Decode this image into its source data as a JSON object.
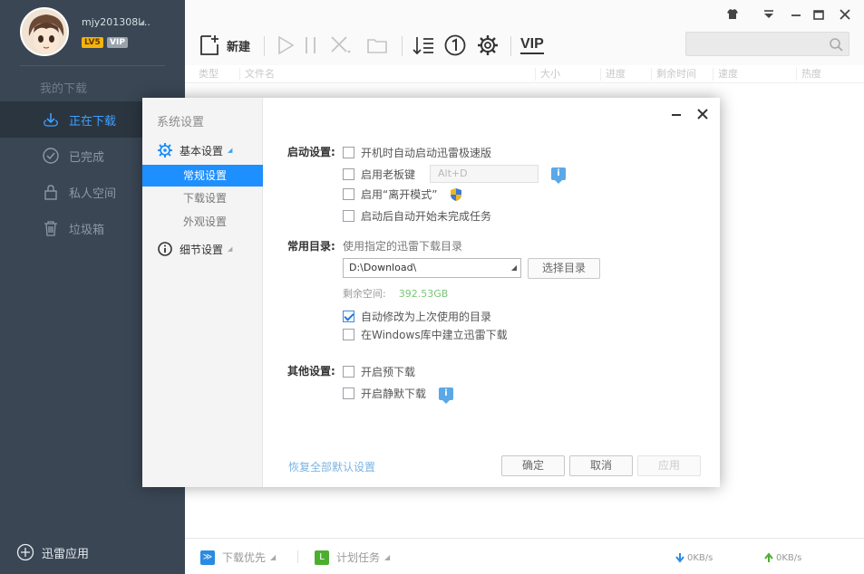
{
  "sidebar": {
    "username": "mjy201308l...",
    "level": "LV5",
    "vip": "VIP",
    "section_title": "我的下载",
    "items": [
      {
        "label": "正在下载",
        "icon": "download-icon",
        "active": true
      },
      {
        "label": "已完成",
        "icon": "check-circle-icon",
        "active": false
      },
      {
        "label": "私人空间",
        "icon": "lock-icon",
        "active": false
      },
      {
        "label": "垃圾箱",
        "icon": "trash-icon",
        "active": false
      }
    ],
    "apps_label": "迅雷应用"
  },
  "toolbar": {
    "new_label": "新建",
    "vip_label": "VIP"
  },
  "columns": [
    "类型",
    "文件名",
    "大小",
    "进度",
    "剩余时间",
    "速度",
    "热度"
  ],
  "statusbar": {
    "priority_label": "下载优先",
    "plan_label": "计划任务",
    "down_speed": "0KB/s",
    "up_speed": "0KB/s"
  },
  "dialog": {
    "title": "系统设置",
    "groups": [
      {
        "label": "基本设置",
        "icon": "gear-icon",
        "subs": [
          "常规设置",
          "下载设置",
          "外观设置"
        ],
        "active_sub": 0
      },
      {
        "label": "细节设置",
        "icon": "info-icon",
        "subs": []
      }
    ],
    "startup": {
      "label": "启动设置:",
      "options": [
        {
          "label": "开机时自动启动迅雷极速版",
          "checked": false
        },
        {
          "label": "启用老板键",
          "checked": false,
          "hotkey": "Alt+D"
        },
        {
          "label": "启用“离开模式”",
          "checked": false
        },
        {
          "label": "启动后自动开始未完成任务",
          "checked": false
        }
      ]
    },
    "directory": {
      "label": "常用目录:",
      "hint": "使用指定的迅雷下载目录",
      "path": "D:\\Download\\",
      "choose_button": "选择目录",
      "free_label": "剩余空间:",
      "free_value": "392.53GB",
      "options": [
        {
          "label": "自动修改为上次使用的目录",
          "checked": true
        },
        {
          "label": "在Windows库中建立迅雷下载",
          "checked": false
        }
      ]
    },
    "other": {
      "label": "其他设置:",
      "options": [
        {
          "label": "开启预下载",
          "checked": false
        },
        {
          "label": "开启静默下载",
          "checked": false
        }
      ]
    },
    "restore_link": "恢复全部默认设置",
    "ok_button": "确定",
    "cancel_button": "取消",
    "apply_button": "应用"
  },
  "colors": {
    "sidebar_bg": "#3a4654",
    "accent": "#1e8fff",
    "active_nav_text": "#3ea0ff"
  }
}
